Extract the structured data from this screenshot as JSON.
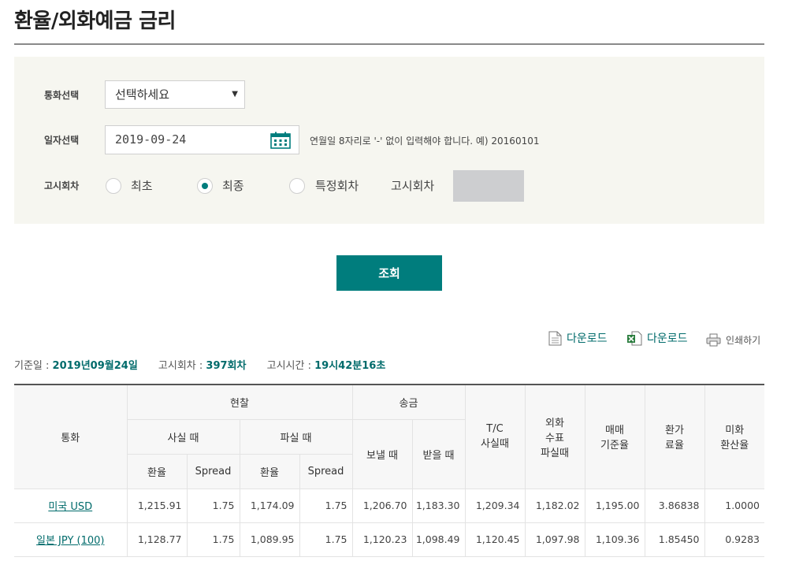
{
  "page_title": "환율/외화예금 금리",
  "form": {
    "currency_label": "통화선택",
    "currency_selected": "선택하세요",
    "date_label": "일자선택",
    "date_value": "2019-09-24",
    "date_hint": "연월일 8자리로 '-' 없이 입력해야 합니다. 예) 20160101",
    "round_label": "고시회차",
    "options": [
      "최초",
      "최종",
      "특정회차"
    ],
    "selected_option": "최종",
    "round_input_label": "고시회차",
    "submit_label": "조회"
  },
  "toolbar": {
    "download_pdf": "다운로드",
    "download_excel": "다운로드",
    "print": "인쇄하기"
  },
  "info": {
    "date_label": "기준일 : ",
    "date_value": "2019년09월24일",
    "round_label": "고시회차 : ",
    "round_value": "397회차",
    "time_label": "고시시간 : ",
    "time_value": "19시42분16초"
  },
  "table": {
    "headers": {
      "currency": "통화",
      "cash": "현찰",
      "cash_buy": "사실 때",
      "cash_sell": "파실 때",
      "remit": "송금",
      "remit_send": "보낼 때",
      "remit_receive": "받을 때",
      "tc_buy": "T/C\n사실때",
      "check_sell": "외화\n수표\n파실때",
      "base_rate": "매매\n기준율",
      "conv_rate": "환가\n료율",
      "usd_rate": "미화\n환산율",
      "rate": "환율",
      "spread": "Spread"
    },
    "rows": [
      [
        "미국 USD",
        "1,215.91",
        "1.75",
        "1,174.09",
        "1.75",
        "1,206.70",
        "1,183.30",
        "1,209.34",
        "1,182.02",
        "1,195.00",
        "3.86838",
        "1.0000"
      ],
      [
        "일본 JPY (100)",
        "1,128.77",
        "1.75",
        "1,089.95",
        "1.75",
        "1,120.23",
        "1,098.49",
        "1,120.45",
        "1,097.98",
        "1,109.36",
        "1.85450",
        "0.9283"
      ]
    ]
  },
  "colors": {
    "accent": "#007d7d",
    "link": "#006b6b",
    "panel_bg": "#f6f6f0"
  }
}
